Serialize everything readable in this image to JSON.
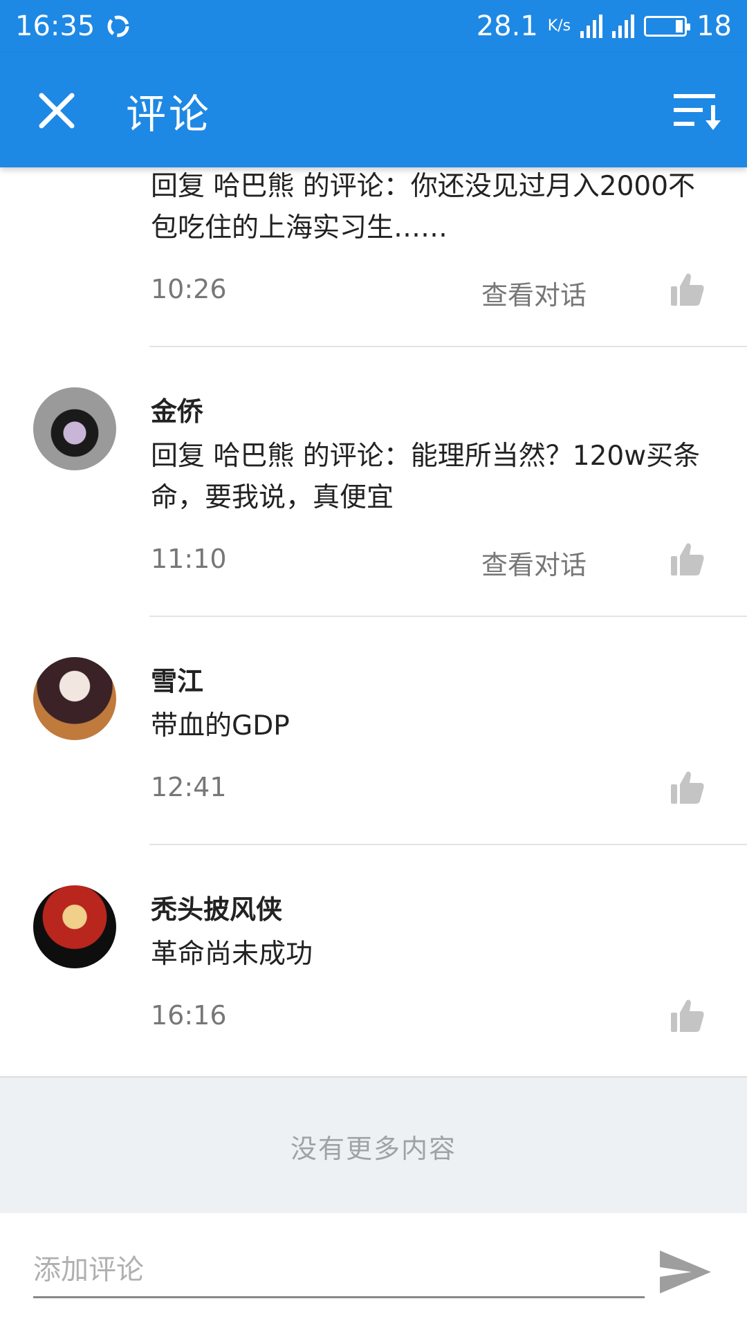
{
  "status_bar": {
    "time": "16:35",
    "network_speed": "28.1",
    "speed_unit": "K/s",
    "battery_level": "18"
  },
  "app_bar": {
    "title": "评论",
    "close_icon": "close-icon",
    "sort_icon": "sort-icon"
  },
  "comments": [
    {
      "author": "",
      "text": "回复 哈巴熊 的评论：你还没见过月入2000不包吃住的上海实习生……",
      "time": "10:26",
      "view_dialog": "查看对话",
      "avatar_color": "#6b7a4a"
    },
    {
      "author": "金侨",
      "text": "回复 哈巴熊 的评论：能理所当然？120w买条命，要我说，真便宜",
      "time": "11:10",
      "view_dialog": "查看对话",
      "avatar_color": "#8a8a8a"
    },
    {
      "author": "雪江",
      "text": "带血的GDP",
      "time": "12:41",
      "view_dialog": "",
      "avatar_color": "#b5673a"
    },
    {
      "author": "秃头披风侠",
      "text": "革命尚未成功",
      "time": "16:16",
      "view_dialog": "",
      "avatar_color": "#1a1a1a"
    }
  ],
  "footer": {
    "no_more": "没有更多内容"
  },
  "composer": {
    "placeholder": "添加评论",
    "send_icon": "send-icon"
  },
  "colors": {
    "primary": "#1e88e5",
    "like_icon": "#c4c4c4"
  }
}
